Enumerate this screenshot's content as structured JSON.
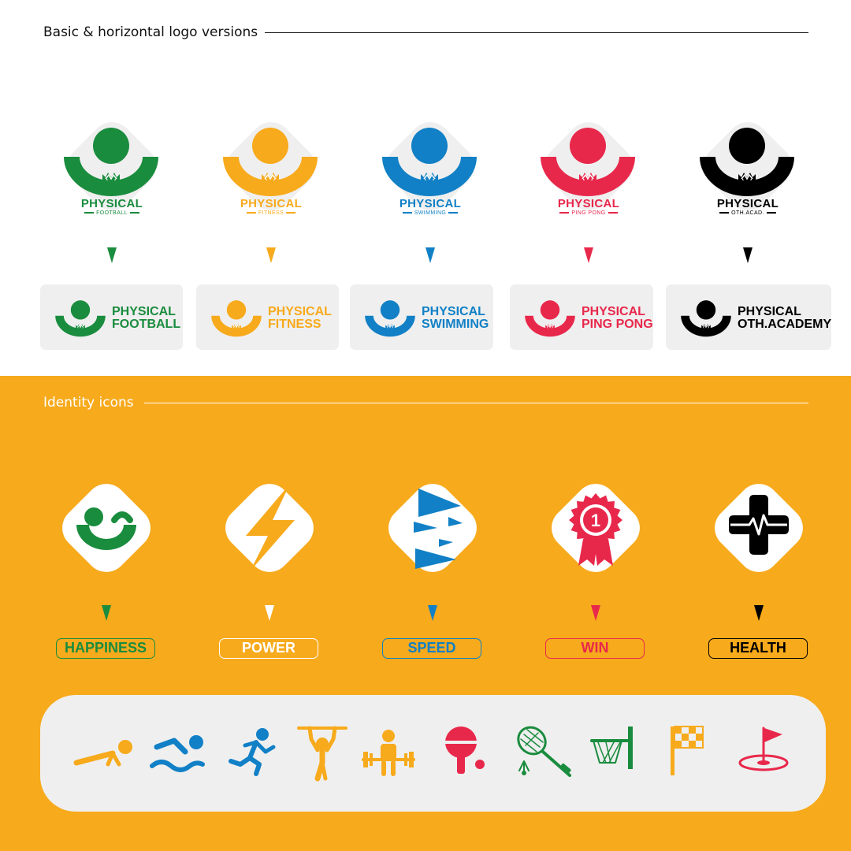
{
  "sections": {
    "logos_title": "Basic & horizontal logo versions",
    "icons_title": "Identity icons"
  },
  "colors": {
    "green": "#1A8C3E",
    "yellow": "#F7AA1C",
    "blue": "#1180C6",
    "red": "#E8284B",
    "black": "#000000",
    "band": "#F7AA1C",
    "light_gray": "#EFEFEF"
  },
  "logos": [
    {
      "name": "PHYSICAL",
      "sub": "FOOTBALL",
      "h_line1": "PHYSICAL",
      "h_line2": "FOOTBALL",
      "color": "#1A8C3E"
    },
    {
      "name": "PHYSICAL",
      "sub": "FITNESS",
      "h_line1": "PHYSICAL",
      "h_line2": "FITNESS",
      "color": "#F7AA1C"
    },
    {
      "name": "PHYSICAL",
      "sub": "SWIMMING",
      "h_line1": "PHYSICAL",
      "h_line2": "SWIMMING",
      "color": "#1180C6"
    },
    {
      "name": "PHYSICAL",
      "sub": "PING PONG",
      "h_line1": "PHYSICAL",
      "h_line2": "PING PONG",
      "color": "#E8284B"
    },
    {
      "name": "PHYSICAL",
      "sub": "OTH.ACAD.",
      "h_line1": "PHYSICAL",
      "h_line2": "OTH.ACADEMY",
      "color": "#000000"
    }
  ],
  "identity_icons": [
    {
      "icon": "smile-wink-icon",
      "label": "HAPPINESS",
      "color": "#1A8C3E"
    },
    {
      "icon": "lightning-bolt-icon",
      "label": "POWER",
      "color": "#F7AA1C"
    },
    {
      "icon": "speed-triangles-icon",
      "label": "SPEED",
      "color": "#1180C6"
    },
    {
      "icon": "award-ribbon-icon",
      "label": "WIN",
      "color": "#E8284B"
    },
    {
      "icon": "health-cross-icon",
      "label": "HEALTH",
      "color": "#000000"
    }
  ],
  "sport_icons": [
    {
      "icon": "pushup-icon",
      "color": "#F7AA1C"
    },
    {
      "icon": "swimmer-icon",
      "color": "#1180C6"
    },
    {
      "icon": "runner-icon",
      "color": "#1180C6"
    },
    {
      "icon": "pullup-bar-icon",
      "color": "#F7AA1C"
    },
    {
      "icon": "weightlifter-icon",
      "color": "#F7AA1C"
    },
    {
      "icon": "ping-pong-paddle-icon",
      "color": "#E8284B"
    },
    {
      "icon": "badminton-icon",
      "color": "#1A8C3E"
    },
    {
      "icon": "basketball-hoop-icon",
      "color": "#1A8C3E"
    },
    {
      "icon": "checkered-flag-icon",
      "color": "#F7AA1C"
    },
    {
      "icon": "golf-flag-icon",
      "color": "#E8284B"
    }
  ]
}
